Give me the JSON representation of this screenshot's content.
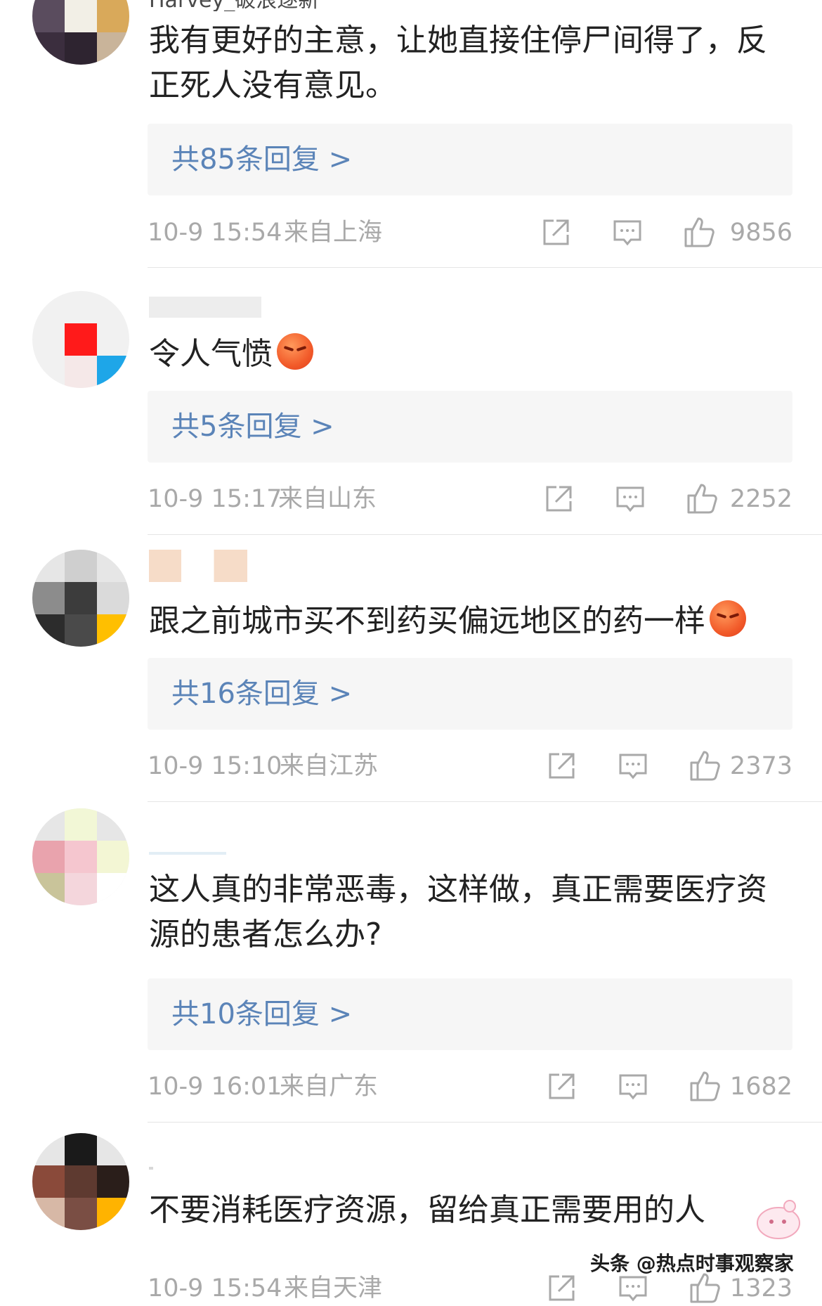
{
  "comments": [
    {
      "name": "Harvey_破浪逐新",
      "text": "我有更好的主意，让她直接住停尸间得了，反正死人没有意见。",
      "replies": "共85条回复 >",
      "time": "10-9 15:54",
      "location": "来自上海",
      "likes": "9856"
    },
    {
      "name": "",
      "text": "令人气愤",
      "replies": "共5条回复 >",
      "time": "10-9 15:17",
      "location": "来自山东",
      "likes": "2252"
    },
    {
      "name": "",
      "text": "跟之前城市买不到药买偏远地区的药一样",
      "replies": "共16条回复 >",
      "time": "10-9 15:10",
      "location": "来自江苏",
      "likes": "2373"
    },
    {
      "name": "",
      "text": "这人真的非常恶毒，这样做，真正需要医疗资源的患者怎么办?",
      "replies": "共10条回复 >",
      "time": "10-9 16:01",
      "location": "来自广东",
      "likes": "1682"
    },
    {
      "name": "",
      "text": "不要消耗医疗资源，留给真正需要用的人",
      "time": "10-9 15:54",
      "location": "来自天津",
      "likes": "1323"
    }
  ],
  "emoji": "angry-face",
  "watermark": "头条 @热点时事观察家",
  "colors": {
    "reply_link": "#5b84b8",
    "meta_text": "#a9a9a9",
    "reply_bg": "#f6f6f6"
  }
}
